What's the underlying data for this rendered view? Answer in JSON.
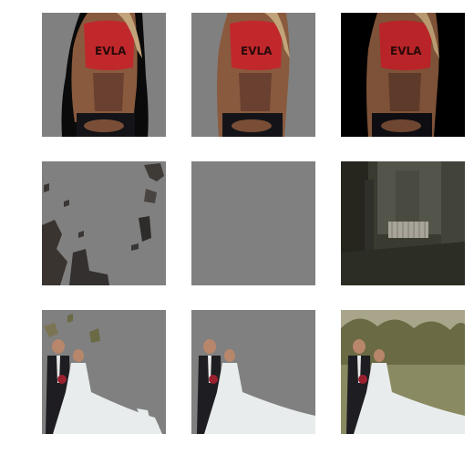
{
  "figure": {
    "rows": [
      {
        "tiles": [
          {
            "name": "fitness-segmented-blackhalo",
            "background": "#808080"
          },
          {
            "name": "fitness-segmented-clean",
            "background": "#808080"
          },
          {
            "name": "fitness-original",
            "background": "#000000"
          }
        ]
      },
      {
        "tiles": [
          {
            "name": "street-segmented-fragments",
            "background": "#808080"
          },
          {
            "name": "street-segmented-empty",
            "background": "#808080"
          },
          {
            "name": "street-original",
            "background": "#3a3b30"
          }
        ]
      },
      {
        "tiles": [
          {
            "name": "wedding-segmented-noisy",
            "background": "#808080"
          },
          {
            "name": "wedding-segmented-clean",
            "background": "#808080"
          },
          {
            "name": "wedding-original",
            "background": "#8f8e6a"
          }
        ]
      }
    ],
    "colors": {
      "mask_gray": "#808080",
      "skin": "#9a6a4c",
      "skin_shadow": "#5a3a28",
      "hair": "#c2a47a",
      "red_top": "#c0282c",
      "dress": "#e8ecec",
      "suit": "#1d1d22",
      "foliage": "#6a6a44"
    }
  }
}
